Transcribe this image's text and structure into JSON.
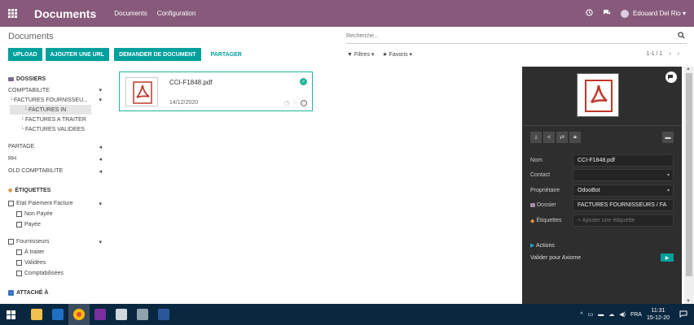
{
  "navbar": {
    "app_title": "Documents",
    "menus": [
      "Documents",
      "Configuration"
    ],
    "user_name": "Edouard Del Rio",
    "icons": [
      "apps-grid-icon",
      "clock-icon",
      "chat-icon",
      "user-avatar"
    ]
  },
  "control": {
    "breadcrumb": "Documents",
    "search_placeholder": "Recherche...",
    "buttons": [
      "UPLOAD",
      "AJOUTER UNE URL",
      "DEMANDER DE DOCUMENT"
    ],
    "share_label": "PARTAGER",
    "filters_label": "Filtres",
    "favorites_label": "Favoris",
    "pager": "1-1 / 1"
  },
  "sidebar": {
    "folders_heading": "DOSSIERS",
    "folders": [
      {
        "label": "COMPTABILITE"
      },
      {
        "label": "FACTURES FOURNISSEU..."
      },
      {
        "label": "FACTURES IN"
      },
      {
        "label": "FACTURES A TRAITER"
      },
      {
        "label": "FACTURES VALIDEES"
      },
      {
        "label": "PARTAGE"
      },
      {
        "label": "RH"
      },
      {
        "label": "OLD COMPTABILITE"
      }
    ],
    "tags_heading": "ÉTIQUETTES",
    "tag_groups": [
      {
        "label": "Etat Paiement Facture",
        "items": [
          "Non Payée",
          "Payée"
        ]
      },
      {
        "label": "Fournisseurs",
        "items": [
          "À traiter",
          "Validées",
          "Comptabilisées"
        ]
      }
    ],
    "attached_heading": "ATTACHÉ À"
  },
  "document": {
    "name": "CCI-F1848.pdf",
    "date": "14/12/2020"
  },
  "panel": {
    "fields": [
      {
        "label": "Nom",
        "value": "CCI-F1848.pdf"
      },
      {
        "label": "Contact",
        "value": ""
      },
      {
        "label": "Propriétaire",
        "value": "OdooBot"
      },
      {
        "label": "Dossier",
        "value": "FACTURES FOURNISSEURS / FA"
      },
      {
        "label": "Étiquettes",
        "value": "+ Ajouter une étiquette"
      }
    ],
    "actions_label": "Actions",
    "validate_label": "Valider pour Axiome"
  },
  "taskbar": {
    "language": "FRA",
    "time": "11:31",
    "date": "15-12-20"
  },
  "colors": {
    "navbar": "#875a7b",
    "accent": "#00a09d",
    "panel_bg": "#2e2e2e",
    "taskbar": "#0a2740",
    "pdf_red": "#c0392b"
  }
}
